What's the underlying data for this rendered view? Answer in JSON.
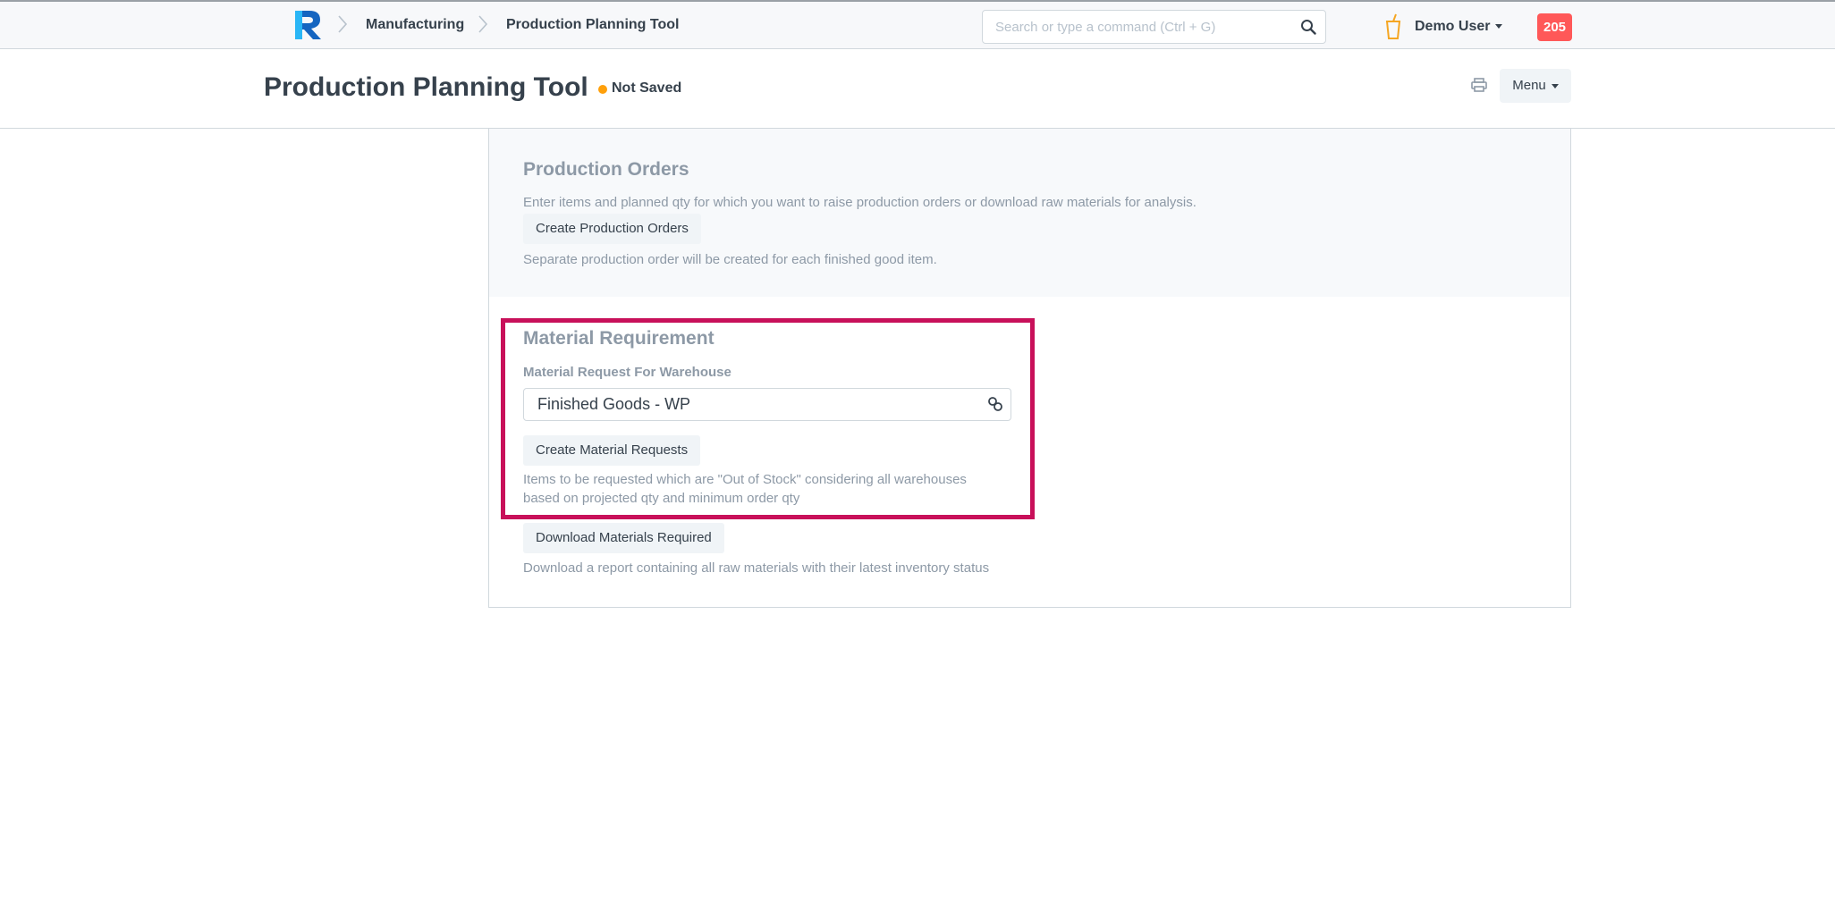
{
  "navbar": {
    "breadcrumbs": [
      "Manufacturing",
      "Production Planning Tool"
    ],
    "search": {
      "placeholder": "Search or type a command (Ctrl + G)",
      "value": ""
    },
    "user_name": "Demo User",
    "notification_count": "205",
    "icons": {
      "logo": "logo-r-icon",
      "separator": "chevron-right-icon",
      "search": "search-icon",
      "user": "cup-icon"
    }
  },
  "page": {
    "title": "Production Planning Tool",
    "status": "Not Saved",
    "status_color": "#ffa00a",
    "menu_label": "Menu",
    "print_icon": "printer-icon"
  },
  "production_orders": {
    "heading": "Production Orders",
    "description": "Enter items and planned qty for which you want to raise production orders or download raw materials for analysis.",
    "button_label": "Create Production Orders",
    "note": "Separate production order will be created for each finished good item."
  },
  "material_requirement": {
    "heading": "Material Requirement",
    "warehouse_label": "Material Request For Warehouse",
    "warehouse_value": "Finished Goods - WP",
    "create_button_label": "Create Material Requests",
    "help_line1": "Items to be requested which are \"Out of Stock\" considering all warehouses",
    "help_line2": "based on projected qty and minimum order qty",
    "download_button_label": "Download Materials Required",
    "download_help": "Download a report containing all raw materials with their latest inventory status",
    "highlight_color": "#c8105a"
  }
}
